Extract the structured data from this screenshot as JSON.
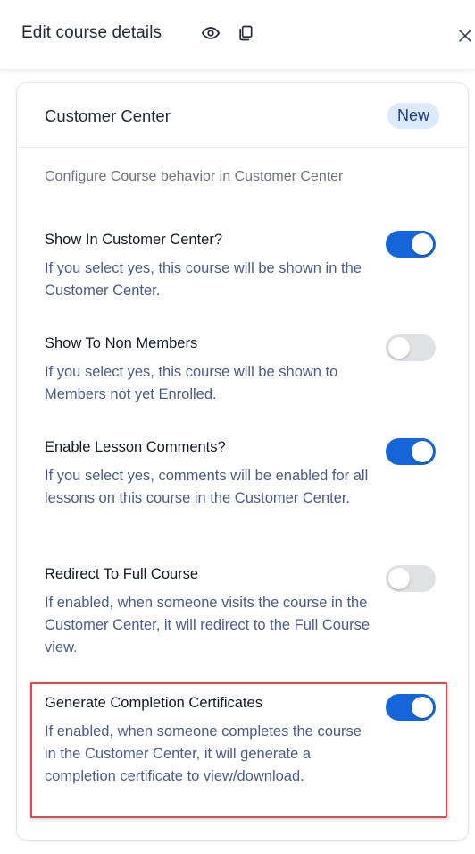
{
  "header": {
    "title": "Edit course details"
  },
  "card": {
    "title": "Customer Center",
    "badge": "New",
    "description": "Configure Course behavior in Customer Center"
  },
  "settings": [
    {
      "title": "Show In Customer Center?",
      "help": "If you select yes, this course will be shown in the Customer Center.",
      "enabled": true
    },
    {
      "title": "Show To Non Members",
      "help": "If you select yes, this course will be shown to Members not yet Enrolled.",
      "enabled": false
    },
    {
      "title": "Enable Lesson Comments?",
      "help": "If you select yes, comments will be enabled for all lessons on this course in the Customer Center.",
      "enabled": true
    },
    {
      "title": "Redirect To Full Course",
      "help": "If enabled, when someone visits the course in the Customer Center, it will redirect to the Full Course view.",
      "enabled": false
    },
    {
      "title": "Generate Completion Certificates",
      "help": "If enabled, when someone completes the course in the Customer Center, it will generate a completion certificate to view/download.",
      "enabled": true
    }
  ],
  "colors": {
    "toggle_on": "#1565d8",
    "toggle_off": "#dfe1e5",
    "highlight": "#e0474c",
    "badge_bg": "#dbeafe"
  }
}
